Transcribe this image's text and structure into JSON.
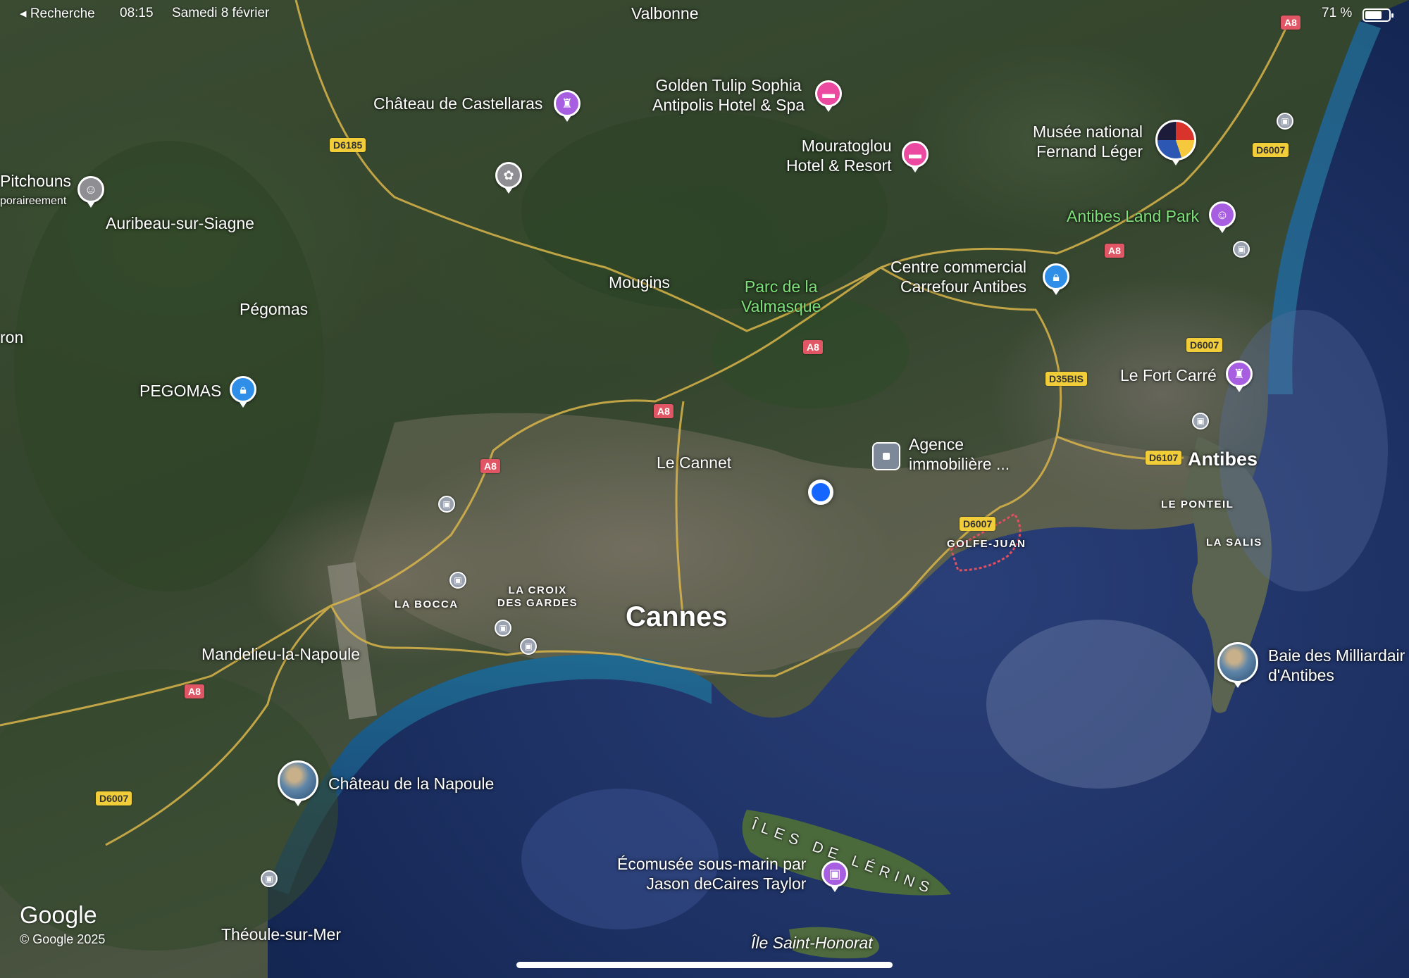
{
  "status_bar": {
    "back_label": "◂ Recherche",
    "time": "08:15",
    "date": "Samedi 8 février",
    "battery_label": "71 %",
    "battery_level": 0.71
  },
  "places": {
    "valbonne": "Valbonne",
    "chateau_castellaras": "Château de Castellaras",
    "golden_tulip": "Golden Tulip Sophia\nAntipolis Hotel & Spa",
    "mouratoglou": "Mouratoglou\nHotel & Resort",
    "musee_leger": "Musée national\nFernand Léger",
    "pitchouns": "Pitchouns",
    "pitchouns_sub": "poraireement",
    "auribeau": "Auribeau-sur-Siagne",
    "antibes_land_park": "Antibes Land Park",
    "centre_commercial": "Centre commercial\nCarrefour Antibes",
    "mougins": "Mougins",
    "parc_valmasque": "Parc de la\nValmasque",
    "pegomas_town": "Pégomas",
    "ron": "ron",
    "pegomas_shop": "PEGOMAS",
    "fort_carre": "Le Fort Carré",
    "agence": "Agence\nimmobilière ...",
    "le_cannet": "Le Cannet",
    "antibes": "Antibes",
    "le_ponteil": "LE PONTEIL",
    "golfe_juan": "GOLFE-JUAN",
    "la_salis": "LA SALIS",
    "la_bocca": "LA BOCCA",
    "la_croix": "LA CROIX\nDES GARDES",
    "cannes": "Cannes",
    "mandelieu": "Mandelieu-la-Napoule",
    "baie_milliardaires": "Baie des Milliardair\nd'Antibes",
    "chateau_napoule": "Château de la Napoule",
    "iles_lerins": "ÎLES DE LÉRINS",
    "ecomusee": "Écomusée sous-marin par\nJason deCaires Taylor",
    "theoule": "Théoule-sur-Mer",
    "saint_honorat": "Île Saint-Honorat"
  },
  "roads": {
    "a8": "A8",
    "d6185": "D6185",
    "d6007": "D6007",
    "d35bis": "D35BIS",
    "d6107": "D6107"
  },
  "attribution": {
    "logo": "Google",
    "copyright": "© Google 2025"
  },
  "colors": {
    "pin_purple": "#a75ee0",
    "pin_pink": "#ec4aa0",
    "pin_blue": "#2f8fe8",
    "user_location": "#1565ff",
    "motorway_shield": "#e15664",
    "dept_shield": "#f2cd3a",
    "park_label": "#7ee07a"
  },
  "icons": {
    "tower": "castle-icon",
    "hotel": "bed-icon",
    "shop": "shopping-bag-icon",
    "train": "train-icon",
    "museum": "museum-icon",
    "amusement": "amusement-park-icon",
    "flower": "flower-icon",
    "childcare": "childcare-icon"
  }
}
